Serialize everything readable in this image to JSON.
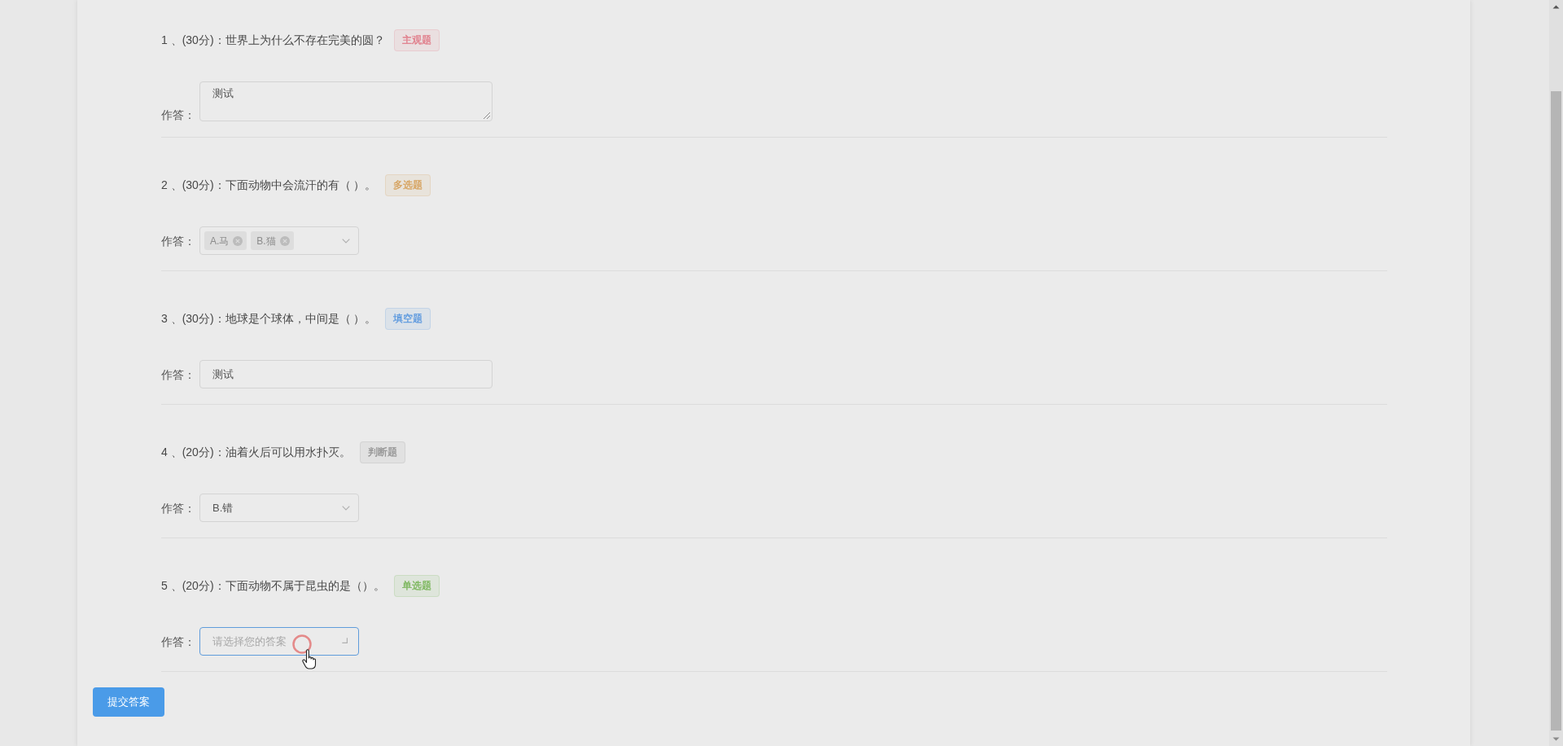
{
  "questions": [
    {
      "title": "1 、(30分)：世界上为什么不存在完美的圆？",
      "tag": {
        "text": "主观题",
        "color": "#e07b88"
      },
      "answer_label": "作答：",
      "answer": {
        "kind": "textarea",
        "value": "测试",
        "focused": false
      }
    },
    {
      "title": "2 、(30分)：下面动物中会流汗的有（ ）。",
      "tag": {
        "text": "多选题",
        "color": "#d6a15c"
      },
      "answer_label": "作答：",
      "answer": {
        "kind": "multi_select",
        "chips": [
          "A.马",
          "B.猫"
        ],
        "focused": false
      }
    },
    {
      "title": "3 、(30分)：地球是个球体，中间是（ ）。",
      "tag": {
        "text": "填空题",
        "color": "#5b98de"
      },
      "answer_label": "作答：",
      "answer": {
        "kind": "input",
        "value": "测试",
        "focused": false
      }
    },
    {
      "title": "4 、(20分)：油着火后可以用水扑灭。",
      "tag": {
        "text": "判断题",
        "color": "#949494"
      },
      "answer_label": "作答：",
      "answer": {
        "kind": "select",
        "value": "B.错",
        "focused": false
      }
    },
    {
      "title": "5 、(20分)：下面动物不属于昆虫的是（）。",
      "tag": {
        "text": "单选题",
        "color": "#78b558"
      },
      "answer_label": "作答：",
      "answer": {
        "kind": "select",
        "placeholder": "请选择您的答案",
        "focused": true
      }
    }
  ],
  "submit_button": "提交答案"
}
